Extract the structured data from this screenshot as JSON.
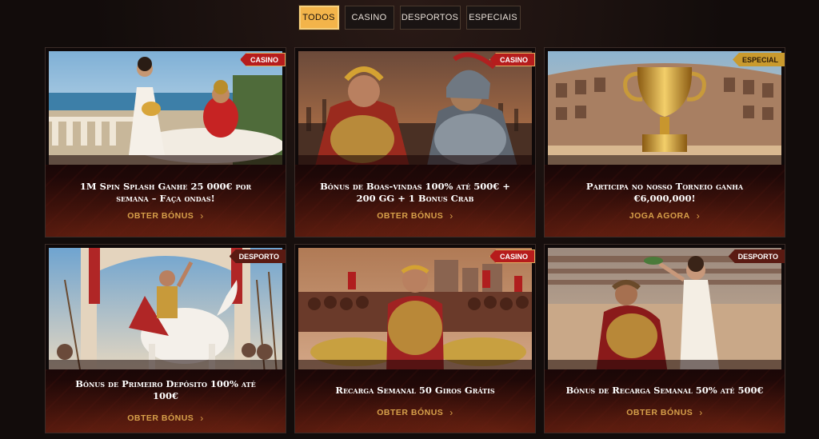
{
  "tabs": [
    {
      "label": "TODOS",
      "active": true
    },
    {
      "label": "CASINO",
      "active": false
    },
    {
      "label": "DESPORTOS",
      "active": false
    },
    {
      "label": "ESPECIAIS",
      "active": false
    }
  ],
  "cards": [
    {
      "badge": "CASINO",
      "badge_type": "casino",
      "title": "1M Spin Splash Ganhe 25 000€ por semana – Faça ondas!",
      "cta": "OBTER BÓNUS",
      "image": "roman-pool-scene"
    },
    {
      "badge": "CASINO",
      "badge_type": "casino",
      "title": "Bónus de Boas-vindas 100% até 500€ + 200 GG + 1 Bonus Crab",
      "cta": "OBTER BÓNUS",
      "image": "gladiators-face-off"
    },
    {
      "badge": "ESPECIAL",
      "badge_type": "especial",
      "title": "Participa no nosso Torneio ganha €6,000,000!",
      "cta": "JOGA AGORA",
      "image": "golden-trophy-colosseum"
    },
    {
      "badge": "DESPORTO",
      "badge_type": "desporto",
      "title": "Bónus de Primeiro Depósito 100% até 100€",
      "cta": "OBTER BÓNUS",
      "image": "emperor-on-horse"
    },
    {
      "badge": "CASINO",
      "badge_type": "casino",
      "title": "Recarga Semanal 50 Giros Grátis",
      "cta": "OBTER BÓNUS",
      "image": "general-with-gold"
    },
    {
      "badge": "DESPORTO",
      "badge_type": "desporto",
      "title": "Bónus de Recarga Semanal 50% até 500€",
      "cta": "OBTER BÓNUS",
      "image": "gladiator-crowned"
    }
  ],
  "colors": {
    "accent": "#f3b44a",
    "cta": "#d7a04a",
    "casino_badge": "#b61c1c",
    "especial_badge": "#c99a2e",
    "desporto_badge": "#5a1a12"
  }
}
